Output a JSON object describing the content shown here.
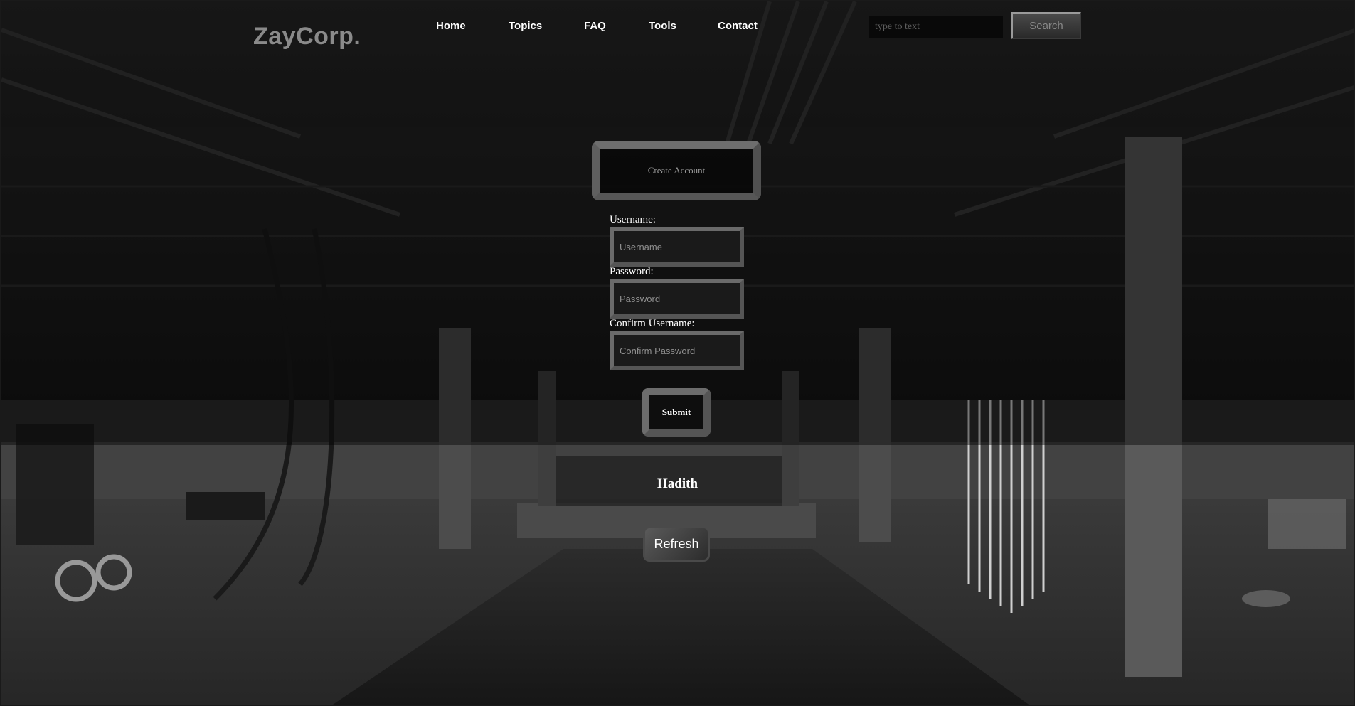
{
  "header": {
    "logo": "ZayCorp.",
    "nav": [
      {
        "label": "Home"
      },
      {
        "label": "Topics"
      },
      {
        "label": "FAQ"
      },
      {
        "label": "Tools"
      },
      {
        "label": "Contact"
      }
    ],
    "search": {
      "placeholder": "type to text",
      "button_label": "Search"
    }
  },
  "form": {
    "title": "Create Account",
    "fields": [
      {
        "label": "Username:",
        "placeholder": "Username"
      },
      {
        "label": "Password:",
        "placeholder": "Password"
      },
      {
        "label": "Confirm Username:",
        "placeholder": "Confirm Password"
      }
    ],
    "submit_label": "Submit"
  },
  "quote": {
    "title": "Hadith",
    "refresh_label": "Refresh"
  },
  "colors": {
    "nav_text": "#ffffff",
    "logo": "#8a8a8a",
    "panel_border": "#6a6a6a"
  }
}
